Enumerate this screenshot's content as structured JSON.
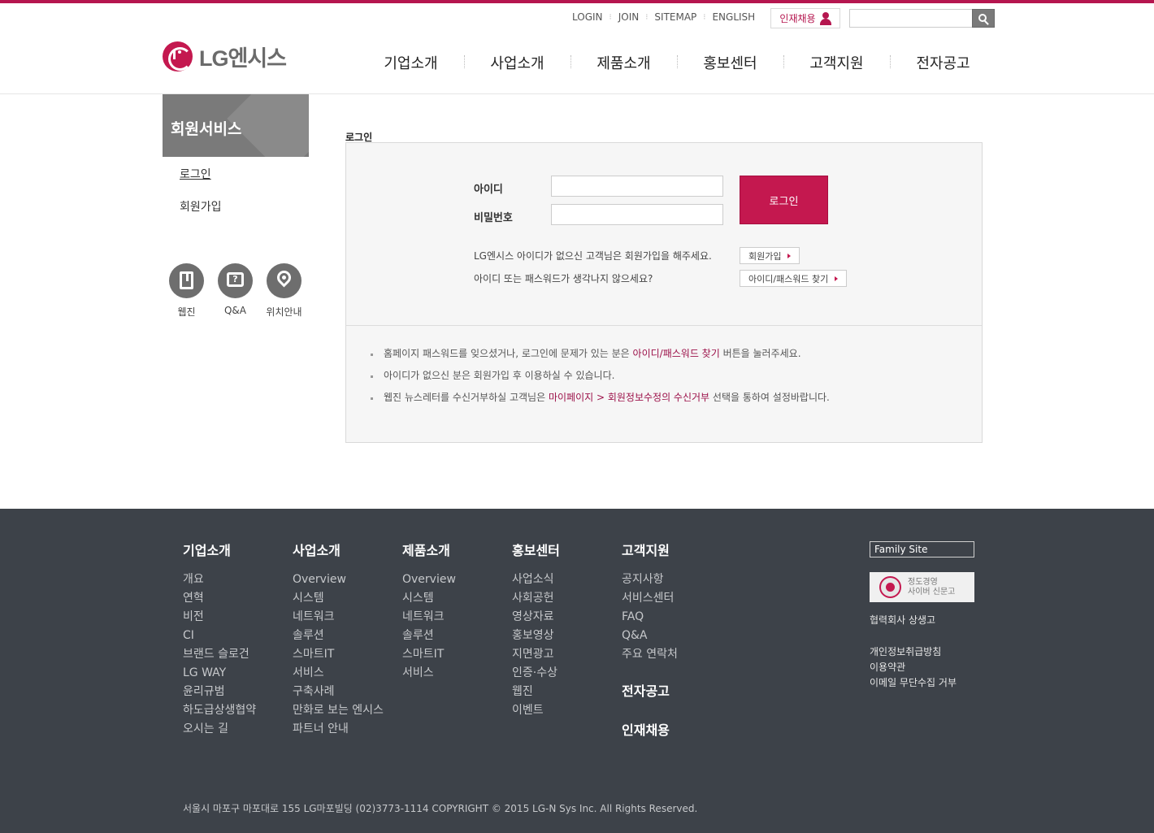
{
  "header": {
    "util_links": [
      "LOGIN",
      "JOIN",
      "SITEMAP",
      "ENGLISH"
    ],
    "recruit_label": "인재채용",
    "search_value": "",
    "logo_text": "LG엔시스",
    "gnb": [
      "기업소개",
      "사업소개",
      "제품소개",
      "홍보센터",
      "고객지원",
      "전자공고"
    ]
  },
  "sidebar": {
    "title": "회원서비스",
    "items": [
      {
        "label": "로그인",
        "active": true
      },
      {
        "label": "회원가입",
        "active": false
      }
    ],
    "quick": [
      {
        "label": "웹진",
        "icon": "book-icon"
      },
      {
        "label": "Q&A",
        "icon": "qa-icon",
        "glyph": "?"
      },
      {
        "label": "위치안내",
        "icon": "location-pin-icon"
      }
    ]
  },
  "content": {
    "page_title": "로그인",
    "id_label": "아이디",
    "pw_label": "비밀번호",
    "id_value": "",
    "pw_value": "",
    "login_button": "로그인",
    "help1": "LG엔시스 아이디가 없으신 고객님은 회원가입을 해주세요.",
    "help1_button": "회원가입",
    "help2": "아이디 또는 패스워드가 생각나지 않으세요?",
    "help2_button": "아이디/패스워드 찾기",
    "notes": [
      {
        "before": "홈페이지 패스워드를 잊으셨거나, 로그인에 문제가 있는 분은 ",
        "highlight": "아이디/패스워드 찾기",
        "after": " 버튼을 눌러주세요."
      },
      {
        "before": "아이디가 없으신 분은 회원가입 후 이용하실 수 있습니다.",
        "highlight": "",
        "after": ""
      },
      {
        "before": "웹진 뉴스레터를 수신거부하실 고객님은 ",
        "highlight": "마이페이지 > 회원정보수정의 수신거부",
        "after": " 선택을 통하여 설정바랍니다."
      }
    ]
  },
  "footer": {
    "columns": [
      {
        "heading": "기업소개",
        "links": [
          "개요",
          "연혁",
          "비전",
          "CI",
          "브랜드 슬로건",
          "LG WAY",
          "윤리규범",
          "하도급상생협약",
          "오시는 길"
        ]
      },
      {
        "heading": "사업소개",
        "links": [
          "Overview",
          "시스템",
          "네트워크",
          "솔루션",
          "스마트IT",
          "서비스",
          "구축사례",
          "만화로 보는 엔시스",
          "파트너 안내"
        ]
      },
      {
        "heading": "제품소개",
        "links": [
          "Overview",
          "시스템",
          "네트워크",
          "솔루션",
          "스마트IT",
          "서비스"
        ]
      },
      {
        "heading": "홍보센터",
        "links": [
          "사업소식",
          "사회공헌",
          "영상자료",
          "홍보영상",
          "지면광고",
          "인증·수상",
          "웹진",
          "이벤트"
        ]
      },
      {
        "heading": "고객지원",
        "links": [
          "공지사항",
          "서비스센터",
          "FAQ",
          "Q&A",
          "주요 연락처"
        ]
      }
    ],
    "extra_headings": [
      "전자공고",
      "인재채용"
    ],
    "family_site": "Family Site",
    "cyber_text": [
      "정도경영",
      "사이버 신문고"
    ],
    "side_links": [
      "협력회사 상생고",
      "개인정보취급방침",
      "이용약관",
      "이메일 무단수집 거부"
    ],
    "copyright": "서울시 마포구 마포대로 155 LG마포빌딩 (02)3773-1114 COPYRIGHT © 2015 LG-N Sys Inc. All Rights Reserved."
  },
  "colors": {
    "accent": "#c4184f",
    "footer_bg": "#3d4249",
    "highlight_text": "#9c1149"
  }
}
